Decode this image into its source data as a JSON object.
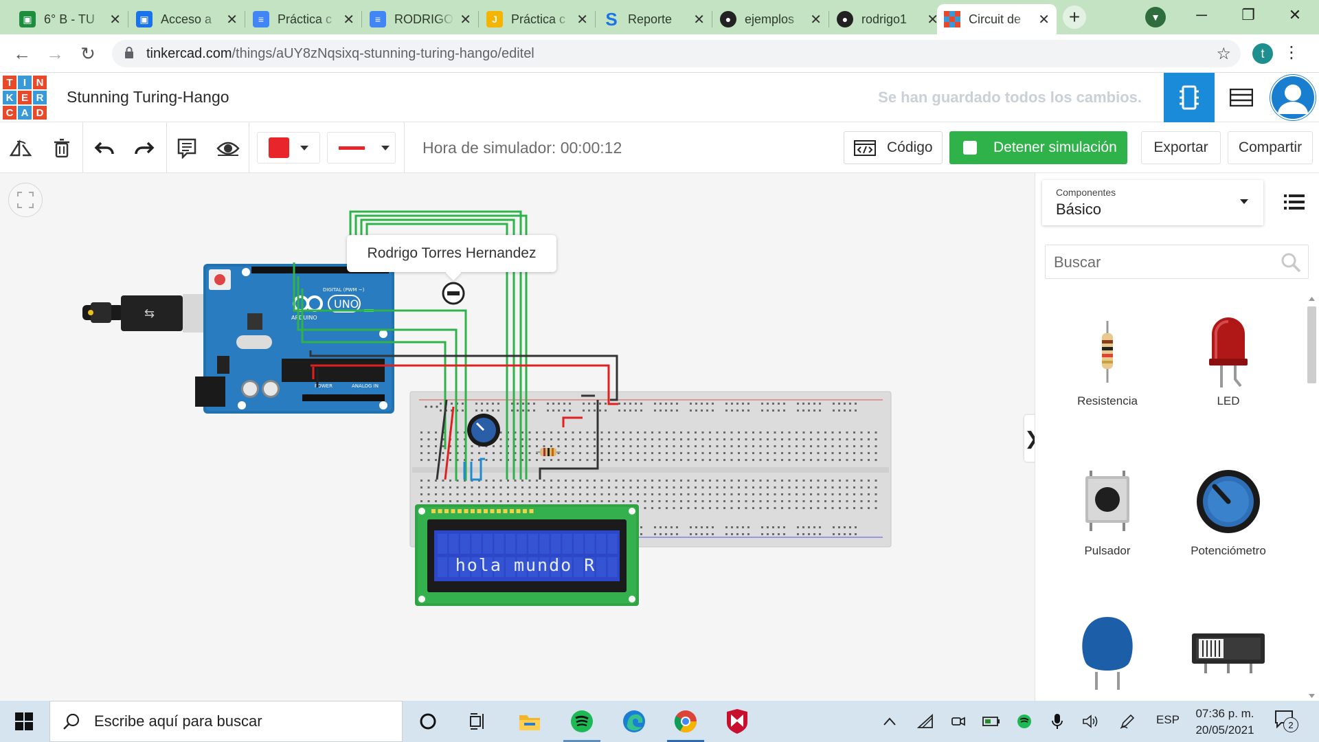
{
  "browser": {
    "tabs": [
      {
        "title": "6° B - TU",
        "icon": "classroom-icon",
        "color": "#1e8e3e",
        "active": false
      },
      {
        "title": "Acceso a",
        "icon": "contacts-icon",
        "color": "#1a73e8",
        "active": false
      },
      {
        "title": "Práctica c",
        "icon": "docs-icon",
        "color": "#4285f4",
        "active": false
      },
      {
        "title": "RODRIGO",
        "icon": "docs-icon",
        "color": "#4285f4",
        "active": false
      },
      {
        "title": "Práctica c",
        "icon": "jamboard-icon",
        "color": "#f4b400",
        "active": false
      },
      {
        "title": "Reporte",
        "icon": "s-icon",
        "color": "#1a73e8",
        "active": false
      },
      {
        "title": "ejemplos",
        "icon": "github-icon",
        "color": "#222222",
        "active": false
      },
      {
        "title": "rodrigo1",
        "icon": "github-icon",
        "color": "#222222",
        "active": false
      },
      {
        "title": "Circuit de",
        "icon": "tinkercad-icon",
        "color": "#e8492b",
        "active": true
      }
    ],
    "new_tab": "+",
    "url_host": "tinkercad.com",
    "url_path": "/things/aUY8zNqsixq-stunning-turing-hango/editel",
    "profile_initial": "t"
  },
  "header": {
    "logo_letters": [
      "T",
      "I",
      "N",
      "K",
      "E",
      "R",
      "C",
      "A",
      "D"
    ],
    "logo_colors": [
      "#e8492b",
      "#3a9ad9",
      "#e8492b",
      "#3a9ad9",
      "#e8492b",
      "#3a9ad9",
      "#e8492b",
      "#3a9ad9",
      "#e8492b"
    ],
    "project_title": "Stunning Turing-Hango",
    "save_status": "Se han guardado todos los cambios."
  },
  "toolbar": {
    "sim_time": "Hora de simulador: 00:00:12",
    "code_label": "Código",
    "stop_label": "Detener simulación",
    "export_label": "Exportar",
    "share_label": "Compartir",
    "fill_color": "#e8252b",
    "wire_color": "#e8252b"
  },
  "canvas": {
    "tooltip": "Rodrigo Torres Hernandez",
    "lcd_text": "hola mundo R",
    "board_label": "UNO",
    "board_brand": "ARDUINO",
    "digital_label": "DIGITAL (PWM ~)",
    "power_label": "POWER",
    "analog_label": "ANALOG IN"
  },
  "panel": {
    "category_label": "Componentes",
    "category_value": "Básico",
    "search_placeholder": "Buscar",
    "parts": [
      {
        "label": "Resistencia",
        "icon": "resistor-icon"
      },
      {
        "label": "LED",
        "icon": "led-icon"
      },
      {
        "label": "Pulsador",
        "icon": "pushbutton-icon"
      },
      {
        "label": "Potenciómetro",
        "icon": "potentiometer-icon"
      },
      {
        "label": "",
        "icon": "capacitor-icon"
      },
      {
        "label": "",
        "icon": "slide-switch-icon"
      }
    ]
  },
  "taskbar": {
    "search_text": "Escribe aquí para buscar",
    "lang": "ESP",
    "time": "07:36 p. m.",
    "date": "20/05/2021",
    "notifications": "2"
  }
}
